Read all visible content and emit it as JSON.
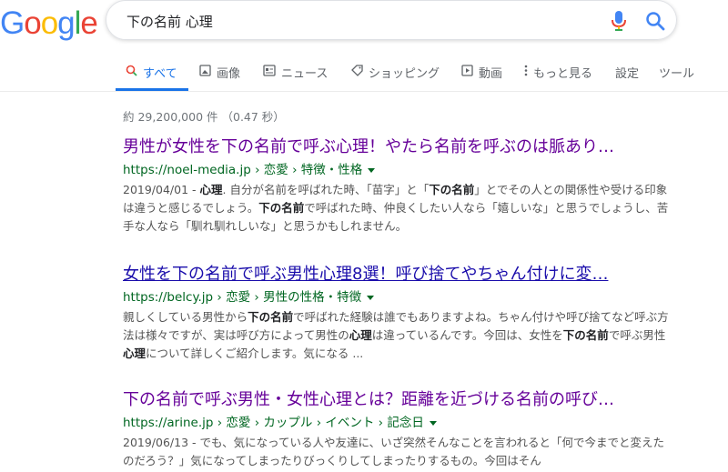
{
  "logo": {
    "letters": [
      "G",
      "o",
      "o",
      "g",
      "l",
      "e"
    ],
    "colors": [
      "#4285F4",
      "#EA4335",
      "#FBBC05",
      "#4285F4",
      "#34A853",
      "#EA4335"
    ]
  },
  "search": {
    "query": "下の名前 心理"
  },
  "tabs": [
    {
      "label": "すべて",
      "icon": "search-icon"
    },
    {
      "label": "画像",
      "icon": "image-icon"
    },
    {
      "label": "ニュース",
      "icon": "news-icon"
    },
    {
      "label": "ショッピング",
      "icon": "tag-icon"
    },
    {
      "label": "動画",
      "icon": "play-icon"
    },
    {
      "label": "もっと見る",
      "icon": "more-dots-icon"
    },
    {
      "label": "設定",
      "icon": ""
    },
    {
      "label": "ツール",
      "icon": ""
    }
  ],
  "stats": "約 29,200,000 件 （0.47 秒）",
  "results": [
    {
      "title": "男性が女性を下の名前で呼ぶ心理！やたら名前を呼ぶのは脈あり…",
      "url": "https://noel-media.jp › 恋愛 › 特徴・性格",
      "snippet_date": "2019/04/01 - ",
      "snippet_bold_1": "心理",
      "snippet_1": ". 自分が名前を呼ばれた時、「苗字」と「",
      "snippet_bold_2": "下の名前",
      "snippet_2": "」とでその人との関係性や受ける印象は違うと感じるでしょう。",
      "snippet_bold_3": "下の名前",
      "snippet_3": "で呼ばれた時、仲良くしたい人なら「嬉しいな」と思うでしょうし、苦手な人なら「馴れ馴れしいな」と思うかもしれません。"
    },
    {
      "title": "女性を下の名前で呼ぶ男性心理8選！呼び捨てやちゃん付けに変…",
      "url": "https://belcy.jp › 恋愛 › 男性の性格・特徴",
      "snippet_1": "親しくしている男性から",
      "snippet_bold_1": "下の名前",
      "snippet_2": "で呼ばれた経験は誰でもありますよね。ちゃん付けや呼び捨てなど呼ぶ方法は様々ですが、実は呼び方によって男性の",
      "snippet_bold_2": "心理",
      "snippet_3": "は違っているんです。今回は、女性を",
      "snippet_bold_3": "下の名前",
      "snippet_4": "で呼ぶ男性",
      "snippet_bold_4": "心理",
      "snippet_5": "について詳しくご紹介します。気になる ..."
    },
    {
      "title": "下の名前で呼ぶ男性・女性心理とは？距離を近づける名前の呼び…",
      "url": "https://arine.jp › 恋愛 › カップル › イベント › 記念日",
      "snippet_1": "2019/06/13 - でも、気になっている人や友達に、いざ突然そんなことを言われると「何で今までと変えたのだろう？」気になってしまったりびっくりしてしまったりするもの。今回はそん"
    }
  ]
}
